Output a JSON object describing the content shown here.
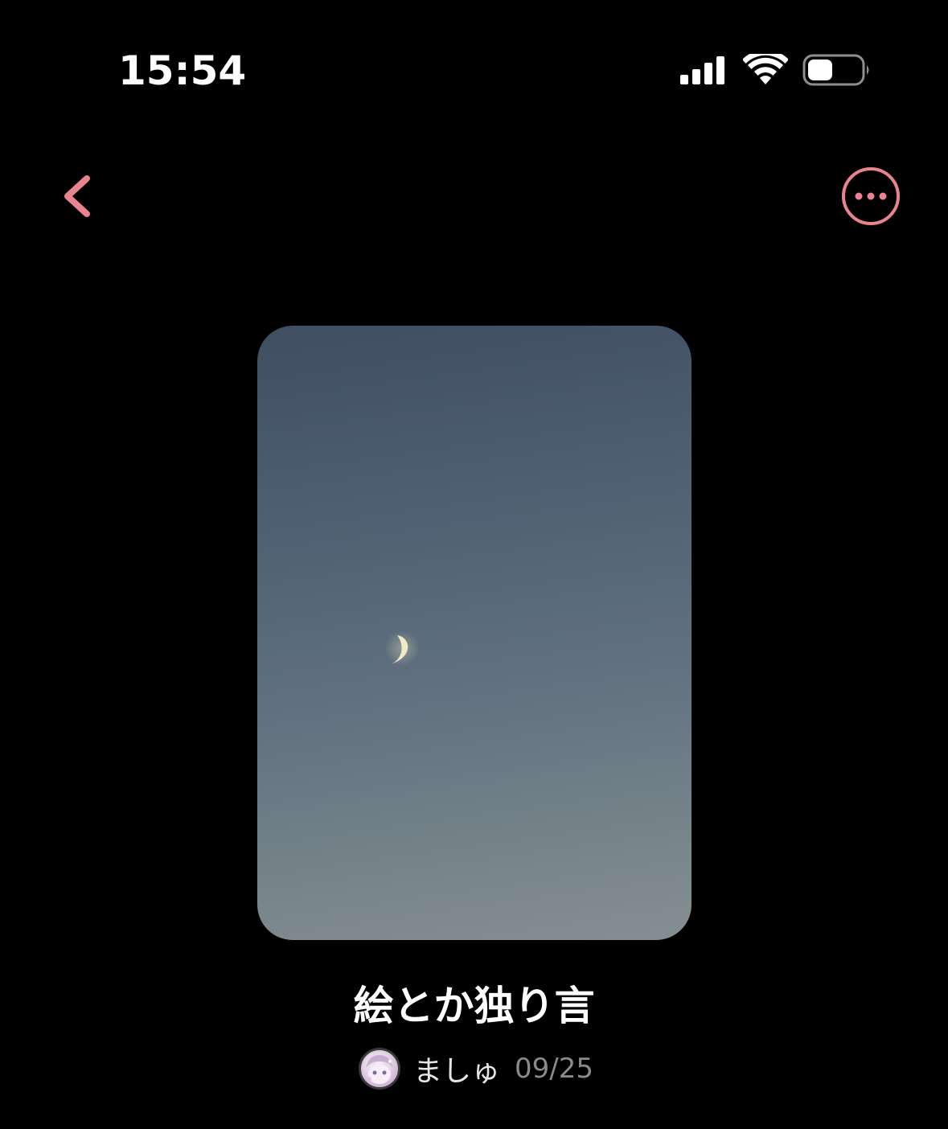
{
  "status_bar": {
    "time": "15:54",
    "icons": [
      "cellular-signal-icon",
      "wifi-icon",
      "battery-icon"
    ]
  },
  "nav": {
    "back_icon": "chevron-left-icon",
    "more_icon": "more-horizontal-circle-icon",
    "accent_color": "#e8838f"
  },
  "post": {
    "cover_image": "night-sky-crescent-moon",
    "title": "絵とか独り言",
    "author": "ましゅ",
    "date": "09/25"
  }
}
